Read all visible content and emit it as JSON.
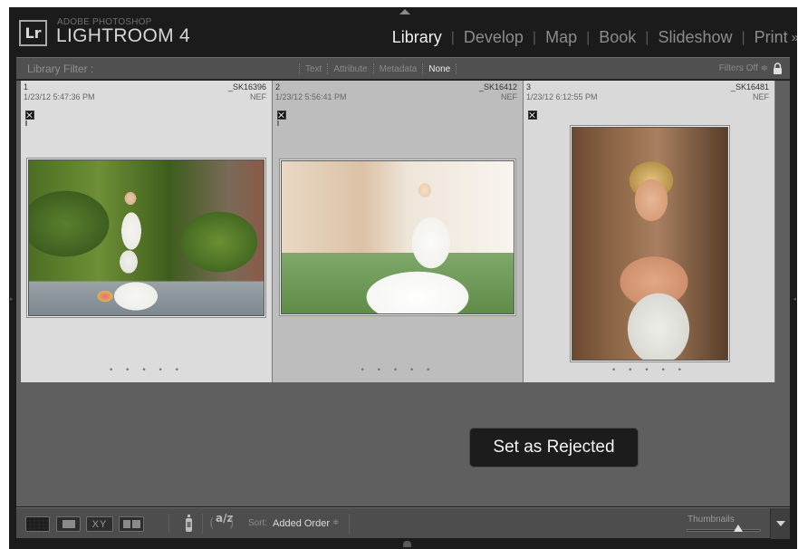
{
  "identity_plate": {
    "badge": "Lr",
    "subtitle": "ADOBE PHOTOSHOP",
    "title": "LIGHTROOM 4"
  },
  "modules": [
    {
      "label": "Library",
      "active": true
    },
    {
      "label": "Develop",
      "active": false
    },
    {
      "label": "Map",
      "active": false
    },
    {
      "label": "Book",
      "active": false
    },
    {
      "label": "Slideshow",
      "active": false
    },
    {
      "label": "Print",
      "active": false
    }
  ],
  "modules_more": "»",
  "filter_bar": {
    "label": "Library Filter :",
    "tabs": [
      {
        "label": "Text",
        "active": false
      },
      {
        "label": "Attribute",
        "active": false
      },
      {
        "label": "Metadata",
        "active": false
      },
      {
        "label": "None",
        "active": true
      }
    ],
    "filters_status": "Filters Off ≑"
  },
  "thumbnails": [
    {
      "index": "1",
      "time": "1/23/12 5:47:36 PM",
      "filename": "_SK16396",
      "type": "NEF",
      "flag": "rejected",
      "rating_dots": "• • • • •",
      "selected": false
    },
    {
      "index": "2",
      "time": "1/23/12 5:56:41 PM",
      "filename": "_SK16412",
      "type": "NEF",
      "flag": "rejected",
      "rating_dots": "• • • • •",
      "selected": true
    },
    {
      "index": "3",
      "time": "1/23/12 6:12:55 PM",
      "filename": "_SK16481",
      "type": "NEF",
      "flag": "rejected",
      "rating_dots": "• • • • •",
      "selected": false
    }
  ],
  "overlay_message": "Set as Rejected",
  "toolbar": {
    "compare_label": "XY",
    "sort_icon": "a/z",
    "sort_label": "Sort:",
    "sort_value": "Added Order",
    "sort_arrows": "≑",
    "thumbnails_label": "Thumbnails",
    "thumbnail_size": 0.7
  },
  "colors": {
    "accent_active_text": "#f0f0f0",
    "inactive_text": "#8c8c8c",
    "panel_dark": "#1b1b1b",
    "grid_bg": "#5f5f5f"
  }
}
